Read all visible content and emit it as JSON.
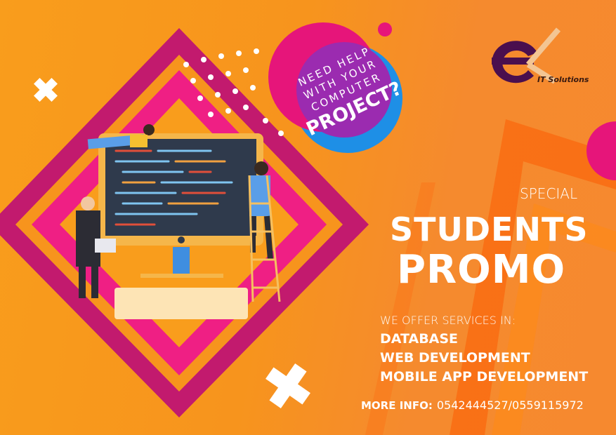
{
  "logo": {
    "letters": "ex",
    "tagline": "IT Solutions"
  },
  "bubble": {
    "line1": "NEED HELP",
    "line2": "WITH YOUR",
    "line3": "COMPUTER",
    "line4": "PROJECT?"
  },
  "headline": {
    "kicker": "SPECIAL",
    "line1": "STUDENTS",
    "line2": "PROMO"
  },
  "services": {
    "intro": "WE OFFER SERVICES IN:",
    "items": [
      "DATABASE",
      "WEB DEVELOPMENT",
      "MOBILE APP DEVELOPMENT"
    ]
  },
  "contact": {
    "label": "MORE INFO:",
    "phones": "0542444527/0559115972"
  },
  "colors": {
    "background": "#f7941d",
    "magenta": "#e6157a",
    "purple": "#9b2bb0",
    "blue": "#1e8fe6",
    "logo_purple": "#4a0f4e"
  }
}
